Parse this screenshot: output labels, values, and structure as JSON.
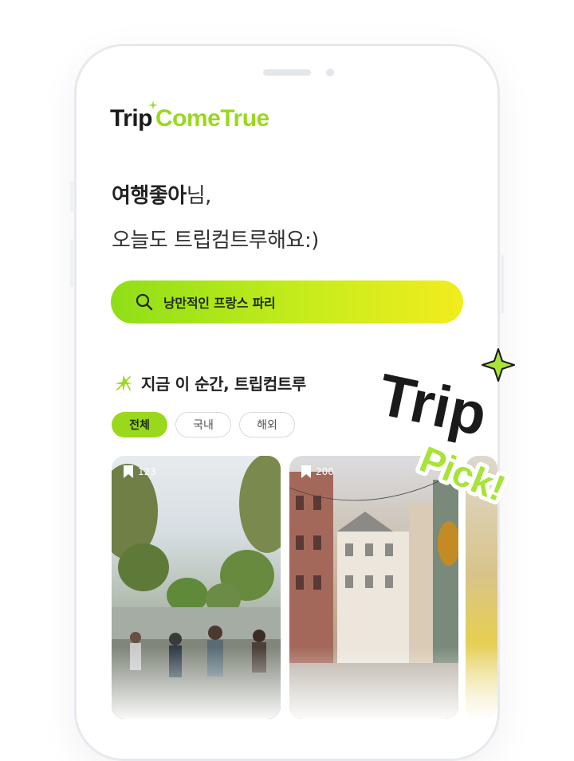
{
  "brand": {
    "trip": "Trip",
    "come_true": "ComeTrue",
    "accent_color": "#9ad81c"
  },
  "greeting": {
    "name": "여행좋아",
    "suffix": "님,",
    "line2": "오늘도 트립컴트루해요:)"
  },
  "search": {
    "icon": "search-icon",
    "text": "낭만적인 프랑스 파리"
  },
  "section": {
    "icon": "sparkle-icon",
    "title": "지금 이 순간, 트립컴트루"
  },
  "filters": [
    {
      "label": "전체",
      "active": true
    },
    {
      "label": "국내",
      "active": false
    },
    {
      "label": "해외",
      "active": false
    }
  ],
  "cards": [
    {
      "bookmark_count": "123",
      "icon": "bookmark-icon"
    },
    {
      "bookmark_count": "200",
      "icon": "bookmark-icon"
    }
  ],
  "sticker": {
    "line1": "Trip",
    "line2": "Pick!"
  }
}
